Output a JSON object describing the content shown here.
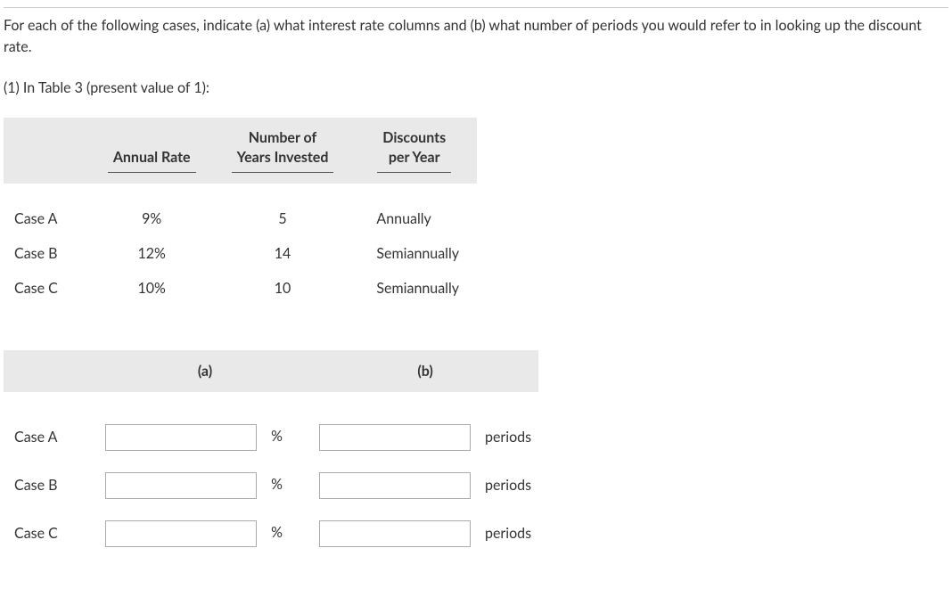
{
  "intro": "For each of the following cases, indicate (a) what interest rate columns and (b) what number of periods you would refer to in looking up the discount rate.",
  "subheading": "(1) In Table 3 (present value of 1):",
  "info_headers": {
    "annual_rate": "Annual Rate",
    "years_invested_l1": "Number of",
    "years_invested_l2": "Years Invested",
    "discounts_l1": "Discounts",
    "discounts_l2": "per Year"
  },
  "rows": [
    {
      "case": "Case A",
      "rate": "9%",
      "years": "5",
      "discounts": "Annually"
    },
    {
      "case": "Case B",
      "rate": "12%",
      "years": "14",
      "discounts": "Semiannually"
    },
    {
      "case": "Case C",
      "rate": "10%",
      "years": "10",
      "discounts": "Semiannually"
    }
  ],
  "answer_headers": {
    "a": "(a)",
    "b": "(b)"
  },
  "answer_rows": [
    {
      "case": "Case A",
      "a_value": "",
      "b_value": ""
    },
    {
      "case": "Case B",
      "a_value": "",
      "b_value": ""
    },
    {
      "case": "Case C",
      "a_value": "",
      "b_value": ""
    }
  ],
  "units": {
    "percent": "%",
    "periods": "periods"
  }
}
